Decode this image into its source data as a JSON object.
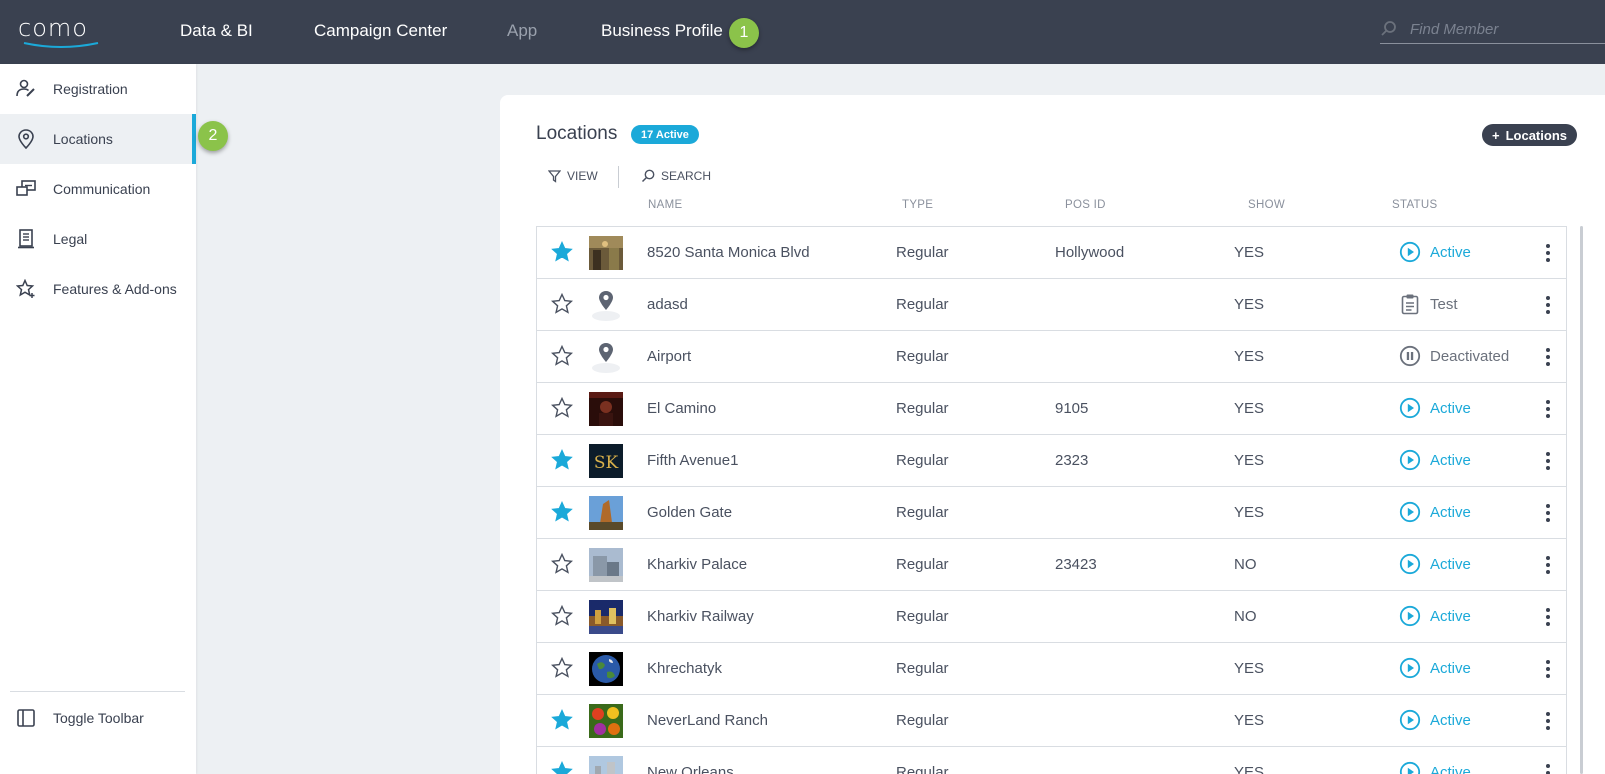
{
  "topbar": {
    "logo": "COMO",
    "nav": [
      "Data & BI",
      "Campaign Center",
      "App",
      "Business Profile"
    ],
    "badge_1": "1",
    "find_member_placeholder": "Find Member"
  },
  "sidebar": {
    "items": [
      "Registration",
      "Locations",
      "Communication",
      "Legal",
      "Features & Add-ons"
    ],
    "badge_2": "2",
    "toggle_toolbar": "Toggle Toolbar"
  },
  "main": {
    "title": "Locations",
    "active_count": "17 Active",
    "add_button": "Locations",
    "view_label": "VIEW",
    "search_label": "SEARCH",
    "columns": [
      "NAME",
      "TYPE",
      "POS ID",
      "SHOW",
      "STATUS"
    ],
    "rows": [
      {
        "starred": true,
        "thumb": "photo-street",
        "name": "8520 Santa Monica Blvd",
        "type": "Regular",
        "pos_id": "Hollywood",
        "show": "YES",
        "status": "Active"
      },
      {
        "starred": false,
        "thumb": "map-pin",
        "name": "adasd",
        "type": "Regular",
        "pos_id": "",
        "show": "YES",
        "status": "Test"
      },
      {
        "starred": false,
        "thumb": "map-pin",
        "name": "Airport",
        "type": "Regular",
        "pos_id": "",
        "show": "YES",
        "status": "Deactivated"
      },
      {
        "starred": false,
        "thumb": "photo-dark",
        "name": "El Camino",
        "type": "Regular",
        "pos_id": "9105",
        "show": "YES",
        "status": "Active"
      },
      {
        "starred": true,
        "thumb": "photo-sk",
        "name": "Fifth Avenue1",
        "type": "Regular",
        "pos_id": "2323",
        "show": "YES",
        "status": "Active"
      },
      {
        "starred": true,
        "thumb": "photo-tower",
        "name": "Golden Gate",
        "type": "Regular",
        "pos_id": "",
        "show": "YES",
        "status": "Active"
      },
      {
        "starred": false,
        "thumb": "photo-building",
        "name": "Kharkiv Palace",
        "type": "Regular",
        "pos_id": "23423",
        "show": "NO",
        "status": "Active"
      },
      {
        "starred": false,
        "thumb": "photo-city",
        "name": "Kharkiv Railway",
        "type": "Regular",
        "pos_id": "",
        "show": "NO",
        "status": "Active"
      },
      {
        "starred": false,
        "thumb": "photo-earth",
        "name": "Khrechatyk",
        "type": "Regular",
        "pos_id": "",
        "show": "YES",
        "status": "Active"
      },
      {
        "starred": true,
        "thumb": "photo-fruit",
        "name": "NeverLand Ranch",
        "type": "Regular",
        "pos_id": "",
        "show": "YES",
        "status": "Active"
      },
      {
        "starred": true,
        "thumb": "photo-sky",
        "name": "New Orleans",
        "type": "Regular",
        "pos_id": "",
        "show": "YES",
        "status": "Active"
      }
    ]
  },
  "colors": {
    "topbar": "#3a4150",
    "accent": "#1ba9d9",
    "badge_green": "#8bc34a",
    "background": "#edf0f3"
  }
}
